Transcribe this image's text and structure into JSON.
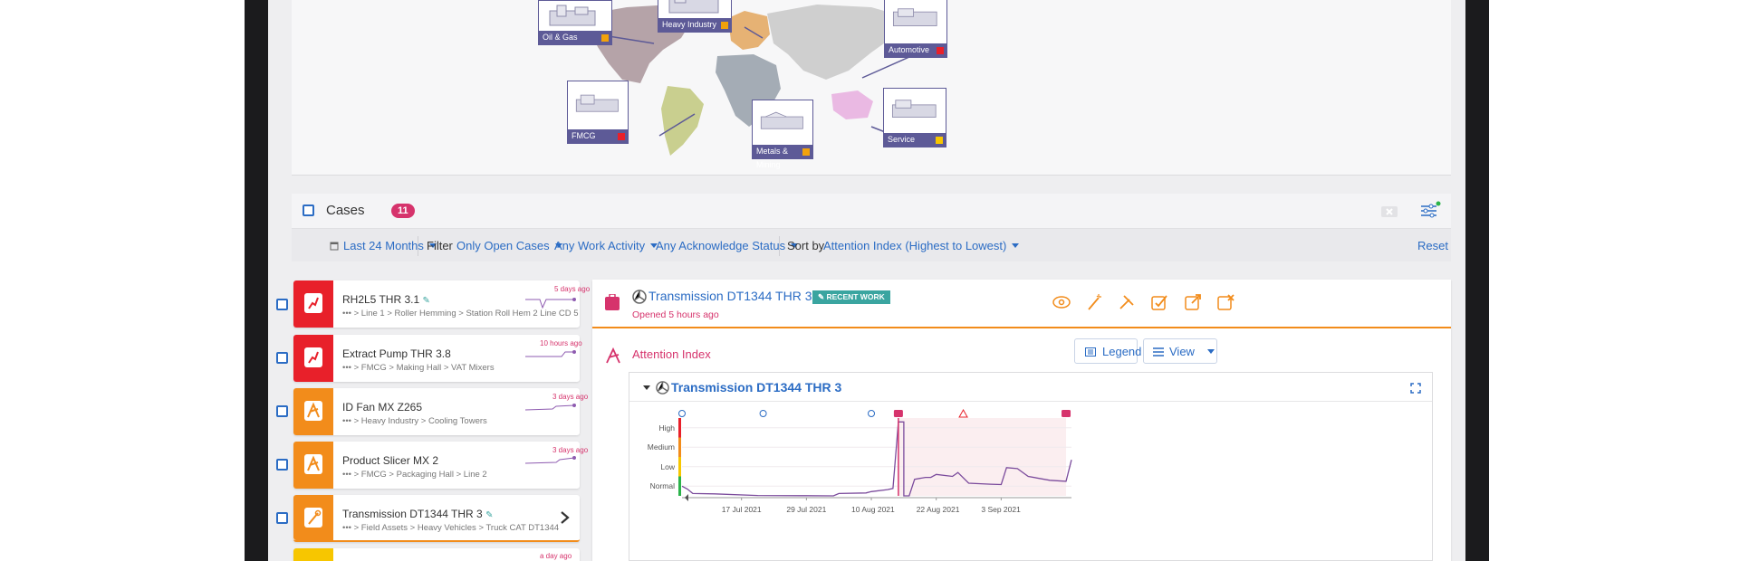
{
  "industries": [
    {
      "label": "Oil & Gas",
      "status_color": "#f2a20c"
    },
    {
      "label": "Heavy Industry",
      "status_color": "#f2a20c"
    },
    {
      "label": "Automotive",
      "status_color": "#e8202a"
    },
    {
      "label": "FMCG",
      "status_color": "#e8202a"
    },
    {
      "label": "Metals & Mining",
      "status_color": "#f2a20c"
    },
    {
      "label": "Service",
      "status_color": "#f7c600"
    }
  ],
  "cases": {
    "title": "Cases",
    "count": "11",
    "filters": {
      "date_range": "Last 24 Months",
      "filter_label": "Filter",
      "open_cases": "Only Open Cases",
      "work_activity": "Any Work Activity",
      "ack_status": "Any Acknowledge Status",
      "sort_label": "Sort by",
      "sort_value": "Attention Index (Highest to Lowest)",
      "reset": "Reset"
    },
    "items": [
      {
        "name": "RH2L5 THR 3.1",
        "path": "> Line 1 > Roller Hemming > Station Roll Hem 2 Line CD 5",
        "ago": "5 days ago",
        "color": "#e8202a",
        "pinned": true
      },
      {
        "name": "Extract Pump THR 3.8",
        "path": "> FMCG > Making Hall > VAT Mixers",
        "ago": "10 hours ago",
        "color": "#e8202a",
        "pinned": false
      },
      {
        "name": "ID Fan MX Z265",
        "path": "> Heavy Industry > Cooling Towers",
        "ago": "3 days ago",
        "color": "#f28c1b",
        "pinned": false
      },
      {
        "name": "Product Slicer MX 2",
        "path": "> FMCG > Packaging Hall > Line 2",
        "ago": "3 days ago",
        "color": "#f28c1b",
        "pinned": false
      },
      {
        "name": "Transmission DT1344 THR 3",
        "path": "> Field Assets > Heavy Vehicles > Truck CAT DT1344",
        "ago": "",
        "color": "#f28c1b",
        "pinned": true
      },
      {
        "name": "",
        "path": "",
        "ago": "a day ago",
        "color": "#f7c600",
        "pinned": false
      }
    ]
  },
  "detail": {
    "title": "Transmission DT1344 THR 3",
    "recent_badge": "RECENT WORK",
    "opened": "Opened 5 hours ago",
    "attention_title": "Attention Index",
    "legend_button": "Legend",
    "view_button": "View",
    "chart_title": "Transmission DT1344 THR 3"
  },
  "chart_data": {
    "type": "line",
    "title": "Transmission DT1344 THR 3",
    "y_categories": [
      "Normal",
      "Low",
      "Medium",
      "High"
    ],
    "x_tick_labels": [
      "17 Jul 2021",
      "29 Jul 2021",
      "10 Aug 2021",
      "22 Aug 2021",
      "3 Sep 2021"
    ],
    "x_range": [
      "2021-07-06",
      "2021-09-16"
    ],
    "series": [
      {
        "x": [
          "2021-07-06",
          "2021-07-07",
          "2021-07-08",
          "2021-07-12",
          "2021-07-20",
          "2021-07-28",
          "2021-08-03",
          "2021-08-04",
          "2021-08-09",
          "2021-08-10",
          "2021-08-13",
          "2021-08-14",
          "2021-08-15",
          "2021-08-16",
          "2021-08-16",
          "2021-08-17",
          "2021-08-18",
          "2021-08-20",
          "2021-08-21",
          "2021-08-22",
          "2021-08-25",
          "2021-08-26",
          "2021-08-28",
          "2021-09-01",
          "2021-09-03",
          "2021-09-04",
          "2021-09-06",
          "2021-09-08",
          "2021-09-12",
          "2021-09-15",
          "2021-09-16"
        ],
        "y": [
          0.5,
          0.35,
          0.12,
          0.1,
          0.02,
          0.01,
          0.0,
          0.12,
          0.15,
          0.22,
          0.32,
          0.38,
          3.8,
          3.8,
          0.0,
          0.0,
          0.85,
          0.95,
          0.95,
          1.1,
          1.0,
          1.2,
          0.65,
          0.6,
          0.58,
          1.45,
          1.4,
          1.0,
          0.8,
          0.75,
          1.85
        ]
      }
    ],
    "events": [
      {
        "x": "2021-07-06",
        "type": "info"
      },
      {
        "x": "2021-07-21",
        "type": "info"
      },
      {
        "x": "2021-08-10",
        "type": "info"
      },
      {
        "x": "2021-08-15",
        "type": "case"
      },
      {
        "x": "2021-08-27",
        "type": "warning"
      },
      {
        "x": "2021-09-15",
        "type": "case"
      }
    ],
    "highlight_range": [
      "2021-08-15",
      "2021-09-15"
    ],
    "level_colors": [
      "#2bb34a",
      "#f7c600",
      "#f28c1b",
      "#e8202a"
    ]
  }
}
